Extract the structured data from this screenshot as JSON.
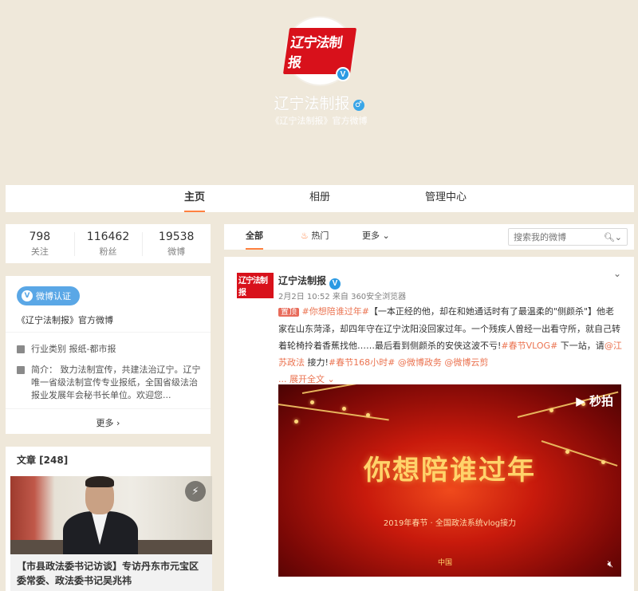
{
  "profile": {
    "logo_text": "辽宁法制报",
    "name": "辽宁法制报",
    "gender_symbol": "♂",
    "description": "《辽宁法制报》官方微博"
  },
  "nav": {
    "tabs": [
      {
        "label": "主页"
      },
      {
        "label": "相册"
      },
      {
        "label": "管理中心"
      }
    ]
  },
  "stats": [
    {
      "value": "798",
      "label": "关注"
    },
    {
      "value": "116462",
      "label": "粉丝"
    },
    {
      "value": "19538",
      "label": "微博"
    }
  ],
  "info": {
    "verify_label": "微博认证",
    "verify_text": "《辽宁法制报》官方微博",
    "industry": "行业类别  报纸-都市报",
    "intro": "简介：  致力法制宣传，共建法治辽宁。辽宁唯一省级法制宣传专业报纸，全国省级法治报业发展年会秘书长单位。欢迎您...",
    "more": "更多 ›"
  },
  "articles": {
    "header": "文章 [248]",
    "title": "【市县政法委书记访谈】专访丹东市元宝区委常委、政法委书记吴兆祎"
  },
  "feed_tabs": {
    "all": "全部",
    "hot": "热门",
    "more": "更多",
    "search_placeholder": "搜索我的微博"
  },
  "post": {
    "avatar_text": "辽宁法制报",
    "author": "辽宁法制报",
    "time": "2月2日 10:52 来自 360安全浏览器",
    "pin": "置顶",
    "hashtag1": "#你想陪谁过年#",
    "body1": "【一本正经的他，却在和她通话时有了最温柔的\"侧颜杀\"】他老家在山东菏泽，却四年守在辽宁沈阳没回家过年。一个残疾人曾经一出看守所，就自己转着轮椅拎着香蕉找他……最后看到侧颜杀的安侠这波不亏!",
    "hashtag2": "#春节VLOG#",
    "body2": " 下一站，请",
    "mention1": "@江苏政法",
    "body3": " 接力!",
    "hashtag3": "#春节168小时#",
    "mention2": "@微博政务",
    "mention3": "@微博云剪",
    "expand": "... 展开全文 ⌄",
    "video": {
      "title": "你想陪谁过年",
      "subtitle": "2019年春节 · 全国政法系统vlog接力",
      "brand": "秒拍",
      "logo_text": "中国"
    }
  }
}
